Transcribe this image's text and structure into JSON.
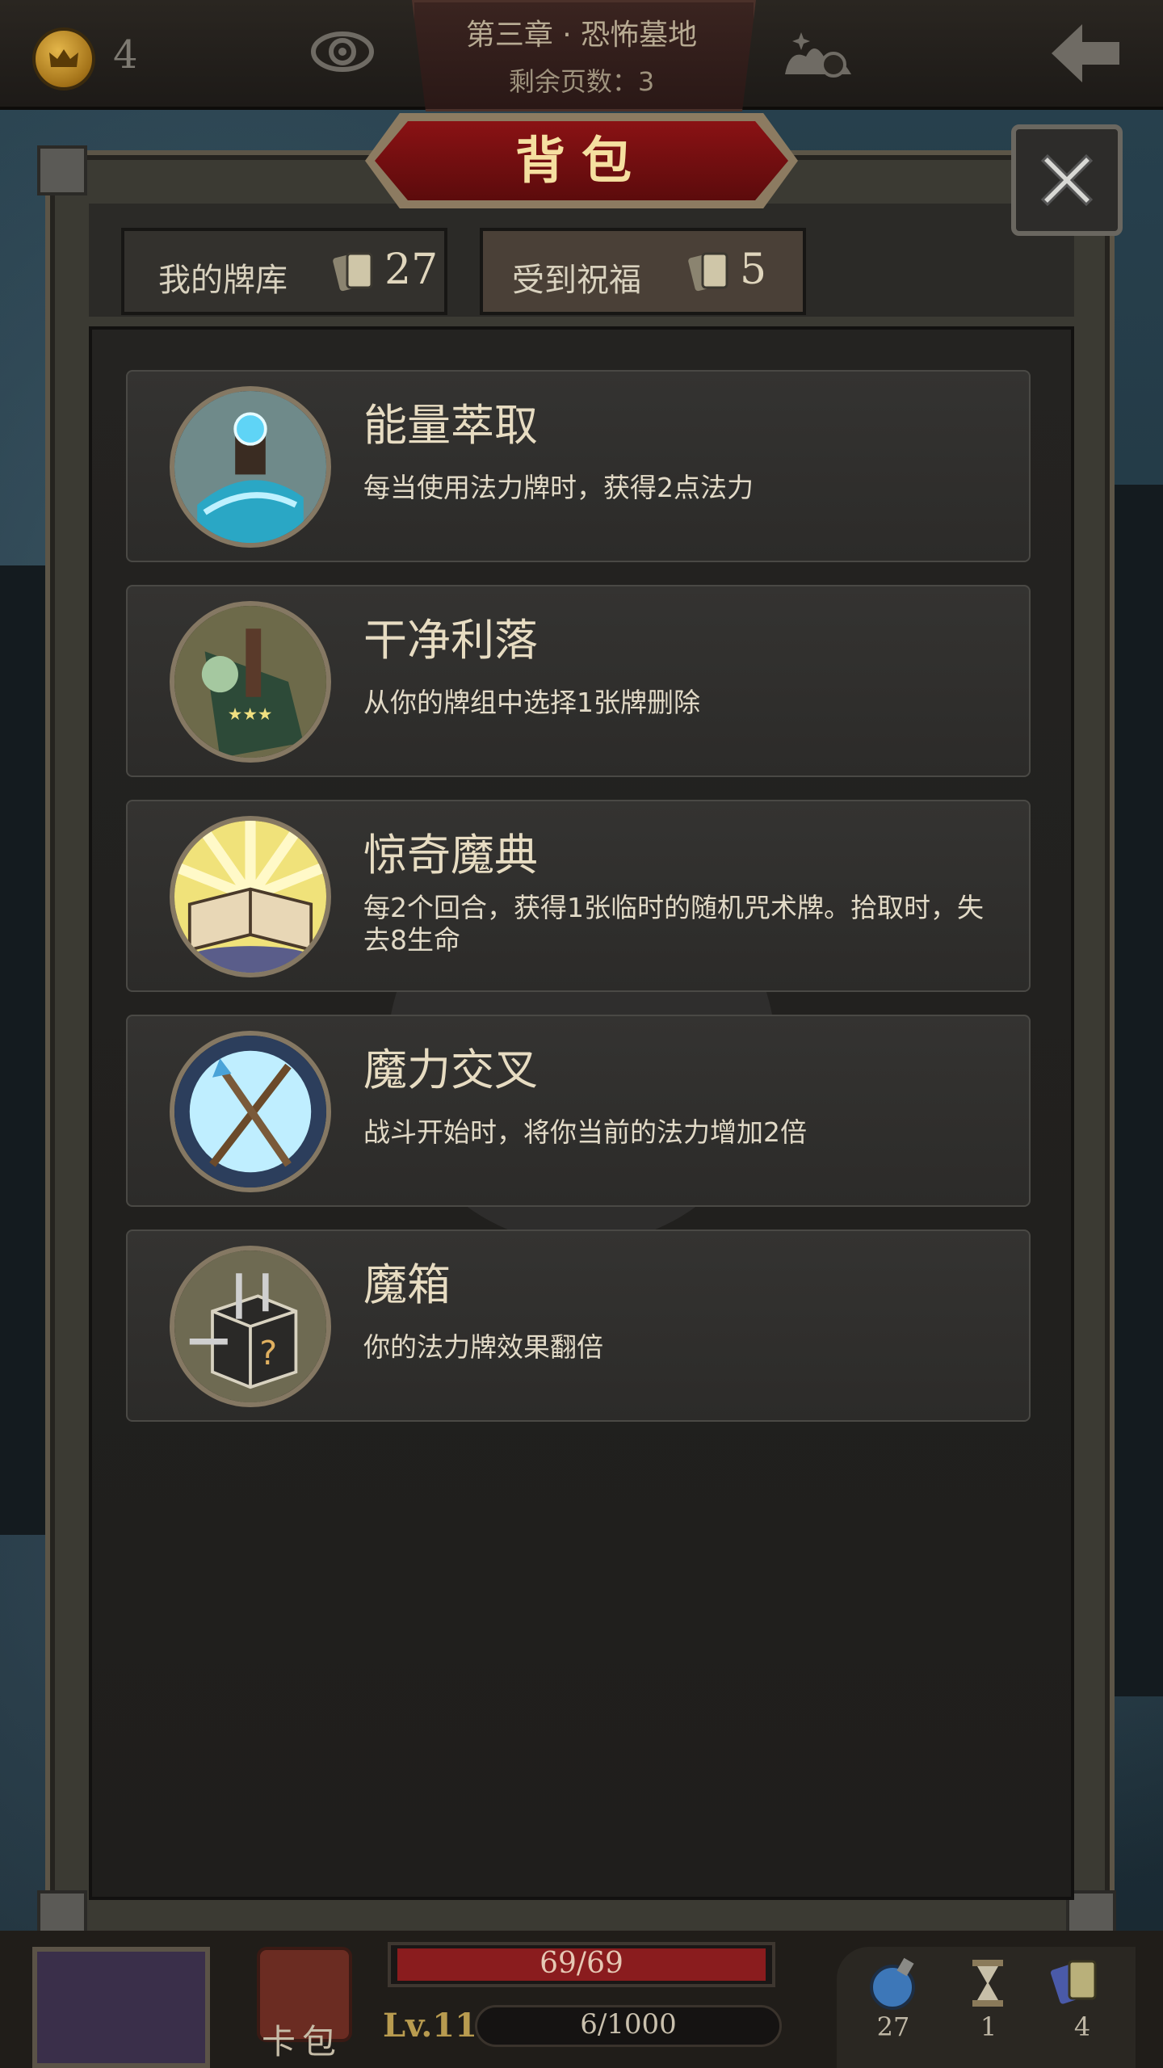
{
  "topbar": {
    "crown_count": "4",
    "chapter_title": "第三章 · 恐怖墓地",
    "pages_remaining": "剩余页数：3"
  },
  "panel": {
    "title": "背包",
    "tabs": [
      {
        "label": "我的牌库",
        "count": "27",
        "selected": false
      },
      {
        "label": "受到祝福",
        "count": "5",
        "selected": true
      }
    ]
  },
  "blessings": [
    {
      "name": "能量萃取",
      "description": "每当使用法力牌时，获得2点法力",
      "icon": "energy-extraction-icon"
    },
    {
      "name": "干净利落",
      "description": "从你的牌组中选择1张牌删除",
      "icon": "clean-cut-icon"
    },
    {
      "name": "惊奇魔典",
      "description": "每2个回合，获得1张临时的随机咒术牌。拾取时，失去8生命",
      "icon": "wonder-grimoire-icon"
    },
    {
      "name": "魔力交叉",
      "description": "战斗开始时，将你当前的法力增加2倍",
      "icon": "magic-cross-icon"
    },
    {
      "name": "魔箱",
      "description": "你的法力牌效果翻倍",
      "icon": "magic-box-icon"
    }
  ],
  "hud": {
    "bag_label": "卡包",
    "hp_text": "69/69",
    "hp_fraction": 1.0,
    "level": "Lv.11",
    "xp_text": "6/1000",
    "potions": "27",
    "hourglass": "1",
    "cards": "4"
  },
  "colors": {
    "title_banner": "#8a1214",
    "title_text": "#f5dfa0",
    "hp_fill": "#8a1c1e",
    "level_text": "#b89b4f"
  }
}
